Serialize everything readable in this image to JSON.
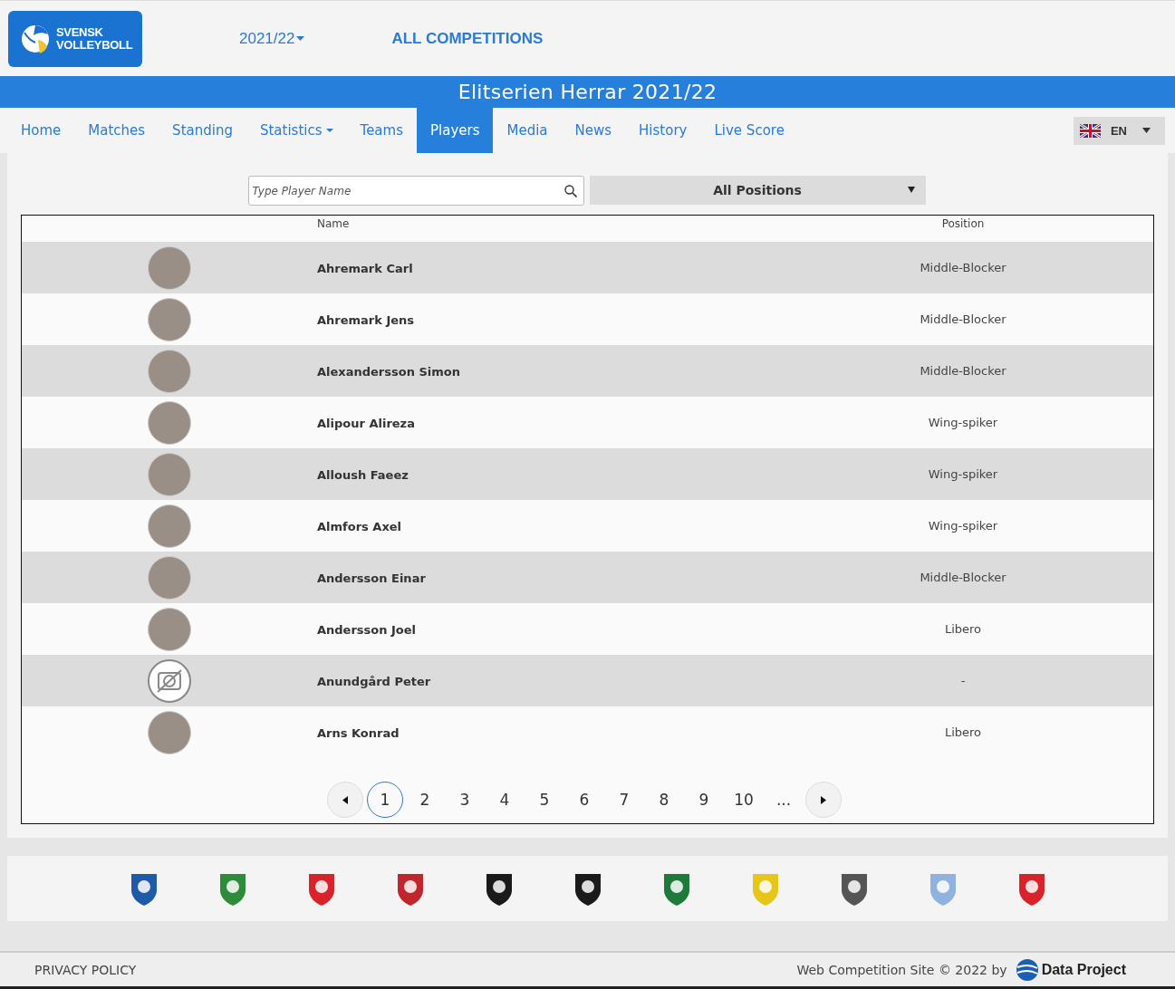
{
  "header": {
    "logo_text": [
      "SVENSK",
      "VOLLEYBOLL"
    ],
    "season": "2021/22",
    "competitions_link": "ALL COMPETITIONS"
  },
  "title": "Elitserien Herrar 2021/22",
  "nav": [
    {
      "label": "Home",
      "selected": false,
      "dropdown": false
    },
    {
      "label": "Matches",
      "selected": false,
      "dropdown": false
    },
    {
      "label": "Standing",
      "selected": false,
      "dropdown": false
    },
    {
      "label": "Statistics",
      "selected": false,
      "dropdown": true
    },
    {
      "label": "Teams",
      "selected": false,
      "dropdown": false
    },
    {
      "label": "Players",
      "selected": true,
      "dropdown": false
    },
    {
      "label": "Media",
      "selected": false,
      "dropdown": false
    },
    {
      "label": "News",
      "selected": false,
      "dropdown": false
    },
    {
      "label": "History",
      "selected": false,
      "dropdown": false
    },
    {
      "label": "Live Score",
      "selected": false,
      "dropdown": false
    }
  ],
  "language": {
    "code": "EN"
  },
  "filters": {
    "search": {
      "placeholder": "Type Player Name"
    },
    "position": "All Positions"
  },
  "table": {
    "columns": [
      "Name",
      "Position"
    ],
    "rows": [
      {
        "has_photo": true,
        "name": "Ahremark Carl",
        "position": "Middle-Blocker"
      },
      {
        "has_photo": true,
        "name": "Ahremark Jens",
        "position": "Middle-Blocker"
      },
      {
        "has_photo": true,
        "name": "Alexandersson Simon",
        "position": "Middle-Blocker"
      },
      {
        "has_photo": true,
        "name": "Alipour Alireza",
        "position": "Wing-spiker"
      },
      {
        "has_photo": true,
        "name": "Alloush Faeez",
        "position": "Wing-spiker"
      },
      {
        "has_photo": true,
        "name": "Almfors Axel",
        "position": "Wing-spiker"
      },
      {
        "has_photo": true,
        "name": "Andersson Einar",
        "position": "Middle-Blocker"
      },
      {
        "has_photo": true,
        "name": "Andersson Joel",
        "position": "Libero"
      },
      {
        "has_photo": false,
        "name": "Anundgård Peter",
        "position": "-"
      },
      {
        "has_photo": true,
        "name": "Arns Konrad",
        "position": "Libero"
      }
    ]
  },
  "pagination": [
    {
      "label": "1",
      "selected": true
    },
    {
      "label": "2",
      "selected": false
    },
    {
      "label": "3",
      "selected": false
    },
    {
      "label": "4",
      "selected": false
    },
    {
      "label": "5",
      "selected": false
    },
    {
      "label": "6",
      "selected": false
    },
    {
      "label": "7",
      "selected": false
    },
    {
      "label": "8",
      "selected": false
    },
    {
      "label": "9",
      "selected": false
    },
    {
      "label": "10",
      "selected": false
    },
    {
      "label": "...",
      "selected": false
    }
  ],
  "team_logos": [
    {
      "color": "#1e5aa8"
    },
    {
      "color": "#2e8b3a"
    },
    {
      "color": "#d8232a"
    },
    {
      "color": "#c0272d"
    },
    {
      "color": "#1a1a1a"
    },
    {
      "color": "#1a1a1a"
    },
    {
      "color": "#1e7a3a"
    },
    {
      "color": "#e6c619"
    },
    {
      "color": "#555555"
    },
    {
      "color": "#8fb3de"
    },
    {
      "color": "#d8232a"
    }
  ],
  "footer": {
    "privacy": "PRIVACY POLICY",
    "credit": "Web Competition Site © 2022 by",
    "brand": "Data Project"
  }
}
